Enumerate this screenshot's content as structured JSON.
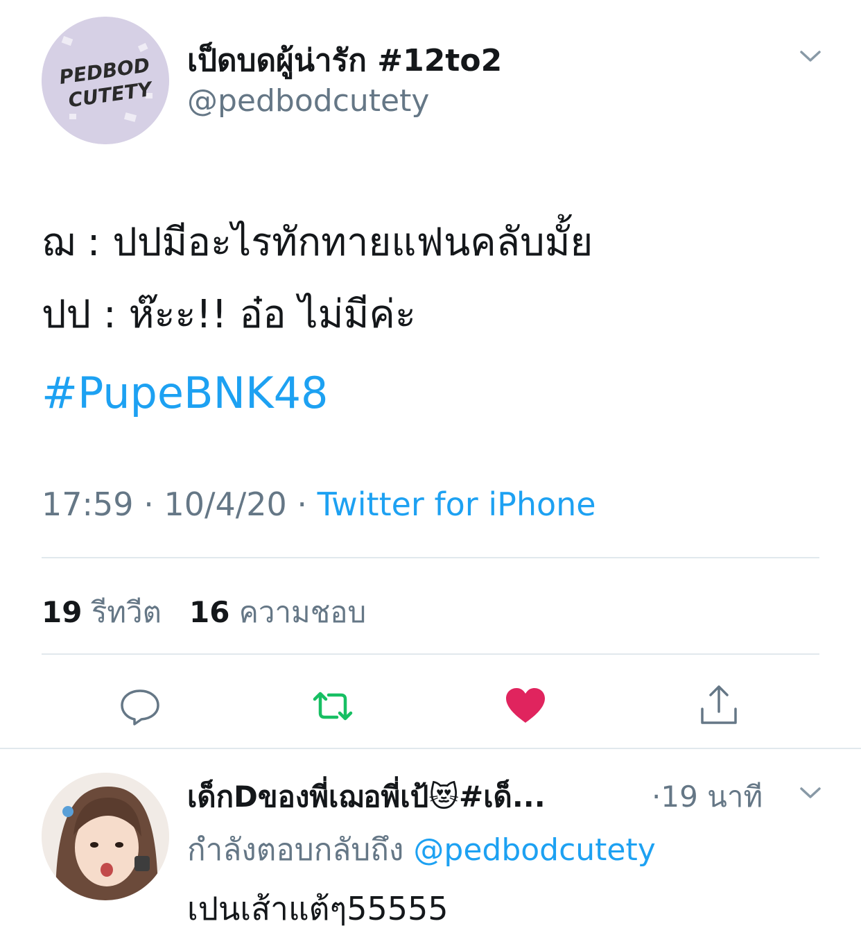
{
  "tweet": {
    "display_name": "เป็ดบดผู้น่ารัก #12to2",
    "handle": "@pedbodcutety",
    "avatar_logo_text": [
      "PEDBOD",
      "CUTETY"
    ],
    "text_line1": "ฌ : ปปมีอะไรทักทายแฟนคลับมั้ย",
    "text_line2": "ปป : ห๊ะะ!! อ๋อ ไม่มีค่ะ",
    "hashtag": "#PupeBNK48",
    "time": "17:59",
    "date": "10/4/20",
    "separator": "·",
    "source": "Twitter for iPhone",
    "retweets_count": "19",
    "retweets_label": "รีทวีต",
    "likes_count": "16",
    "likes_label": "ความชอบ"
  },
  "actions": {
    "reply_icon": "speech-bubble-icon",
    "retweet_icon": "retweet-icon",
    "like_icon": "heart-icon",
    "share_icon": "share-icon"
  },
  "colors": {
    "accent": "#1da1f2",
    "retweet_green": "#17bf63",
    "like_red": "#e0245e",
    "secondary_text": "#657786",
    "divider": "#e1e8ed"
  },
  "reply": {
    "display_name": "เด็กDของพี่เฌอพี่เป้😻#เด็...",
    "time": "·19 นาที",
    "replying_prefix": "กำลังตอบกลับถึง",
    "replying_mention": "@pedbodcutety",
    "text": "เปนเส้าแต้ๆ55555"
  }
}
